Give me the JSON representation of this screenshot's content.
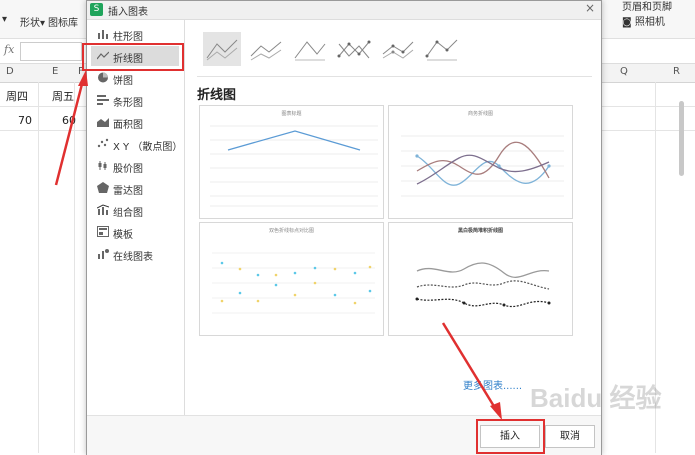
{
  "toolbar": {
    "shapes_label": "形状",
    "iconlib_label": "图标库",
    "header_footer_label": "页眉和页脚",
    "camera_label": "照相机"
  },
  "formula_bar": {
    "fx": "fx"
  },
  "sheet": {
    "columns": [
      {
        "name": "D"
      },
      {
        "name": "E"
      },
      {
        "name": "F"
      },
      {
        "name": "Q"
      },
      {
        "name": "R"
      }
    ],
    "row1": {
      "d": "周四",
      "e": "周五"
    },
    "row2": {
      "d": "70",
      "e": "60"
    }
  },
  "dialog": {
    "title": "插入图表",
    "close": "×",
    "sidebar": [
      {
        "label": "柱形图",
        "icon": "column-chart-icon"
      },
      {
        "label": "折线图",
        "icon": "line-chart-icon",
        "selected": true
      },
      {
        "label": "饼图",
        "icon": "pie-chart-icon"
      },
      {
        "label": "条形图",
        "icon": "bar-chart-icon"
      },
      {
        "label": "面积图",
        "icon": "area-chart-icon"
      },
      {
        "label": "X Y （散点图）",
        "icon": "scatter-chart-icon"
      },
      {
        "label": "股价图",
        "icon": "stock-chart-icon"
      },
      {
        "label": "雷达图",
        "icon": "radar-chart-icon"
      },
      {
        "label": "组合图",
        "icon": "combo-chart-icon"
      },
      {
        "label": "模板",
        "icon": "template-icon"
      },
      {
        "label": "在线图表",
        "icon": "online-chart-icon"
      }
    ],
    "section_title": "折线图",
    "cards": [
      {
        "title": "图表标题"
      },
      {
        "title": "商务折线图"
      },
      {
        "title": "双色折线标点对比图"
      },
      {
        "title": "黑白极简堆积折线图"
      }
    ],
    "more_charts": "更多图表......",
    "insert_button": "插入",
    "cancel_button": "取消"
  },
  "watermark": "Baidu 经验",
  "colors": {
    "highlight_red": "#e03030",
    "link_blue": "#2f7fc9",
    "app_green": "#1fa45b"
  }
}
